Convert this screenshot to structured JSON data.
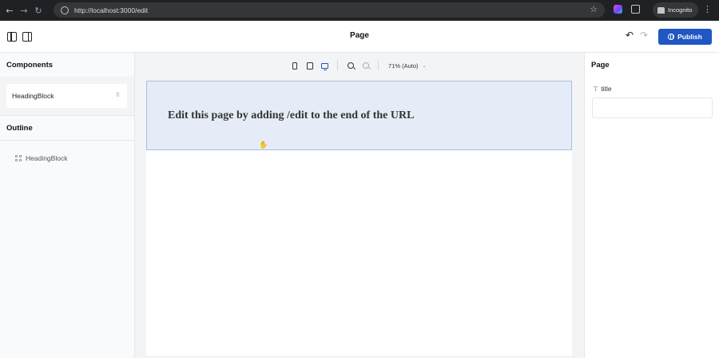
{
  "browser": {
    "url": "http://localhost:3000/edit",
    "incognito_label": "Incognito",
    "icons": [
      "back-arrow-icon",
      "forward-arrow-icon",
      "reload-icon",
      "site-info-icon",
      "bookmark-star-icon",
      "extension-icon",
      "puzzle-icon",
      "incognito-icon",
      "kebab-menu-icon"
    ],
    "glyphs": {
      "back": "←",
      "forward": "→",
      "reload": "↻",
      "star": "☆",
      "kebab": "⋮"
    }
  },
  "header": {
    "title": "Page",
    "publish_label": "Publish",
    "glyphs": {
      "undo": "↶",
      "redo": "↷"
    },
    "accent_color": "#1f57c3"
  },
  "left_sidebar": {
    "components_title": "Components",
    "components": [
      {
        "label": "HeadingBlock",
        "grip": "⠿"
      }
    ],
    "outline_title": "Outline",
    "outline_items": [
      {
        "label": "HeadingBlock"
      }
    ]
  },
  "toolbar": {
    "viewports": [
      "mobile",
      "tablet",
      "desktop"
    ],
    "selected_viewport": "desktop",
    "zoom_label": "71% (Auto)",
    "chevron": "⌄"
  },
  "canvas": {
    "heading_text": "Edit this page by adding /edit to the end of the URL",
    "cursor_glyph": "✋",
    "highlight_color": "#e5ecf7"
  },
  "right_sidebar": {
    "title": "Page",
    "fields": [
      {
        "label": "title",
        "type_glyph": "T",
        "value": ""
      }
    ]
  }
}
